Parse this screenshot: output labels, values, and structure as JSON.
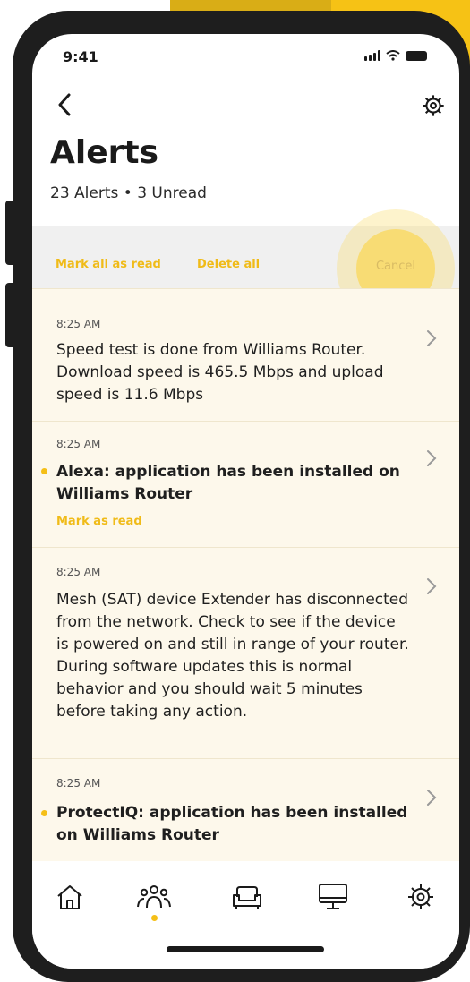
{
  "status_bar": {
    "time": "9:41"
  },
  "header": {
    "title": "Alerts",
    "subtitle": "23 Alerts • 3 Unread"
  },
  "actions": {
    "mark_all_read": "Mark all as read",
    "delete_all": "Delete all",
    "cancel": "Cancel"
  },
  "alerts": [
    {
      "time": "8:25 AM",
      "message": "Speed test is done from Williams Router. Download speed is 465.5 Mbps and upload speed is 11.6 Mbps",
      "unread": false
    },
    {
      "time": "8:25 AM",
      "message": "Alexa: application has been installed on Williams Router",
      "unread": true,
      "mark_label": "Mark as read"
    },
    {
      "time": "8:25 AM",
      "message": "Mesh (SAT) device Extender has disconnected from the network. Check to see if the device is powered on and still in range of your router. During software updates this is normal behavior and you should wait 5 minutes before taking any action.",
      "unread": false
    },
    {
      "time": "8:25 AM",
      "message": "ProtectIQ: application has been installed on Williams Router",
      "unread": true
    }
  ],
  "tab_bar": {
    "tabs": [
      "home-icon",
      "people-icon",
      "car-icon",
      "monitor-icon",
      "gear-icon"
    ],
    "active": "people-icon"
  },
  "colors": {
    "accent": "#f5bf17",
    "list_background": "#fdf8eb",
    "action_bar": "#f0f0f0"
  }
}
